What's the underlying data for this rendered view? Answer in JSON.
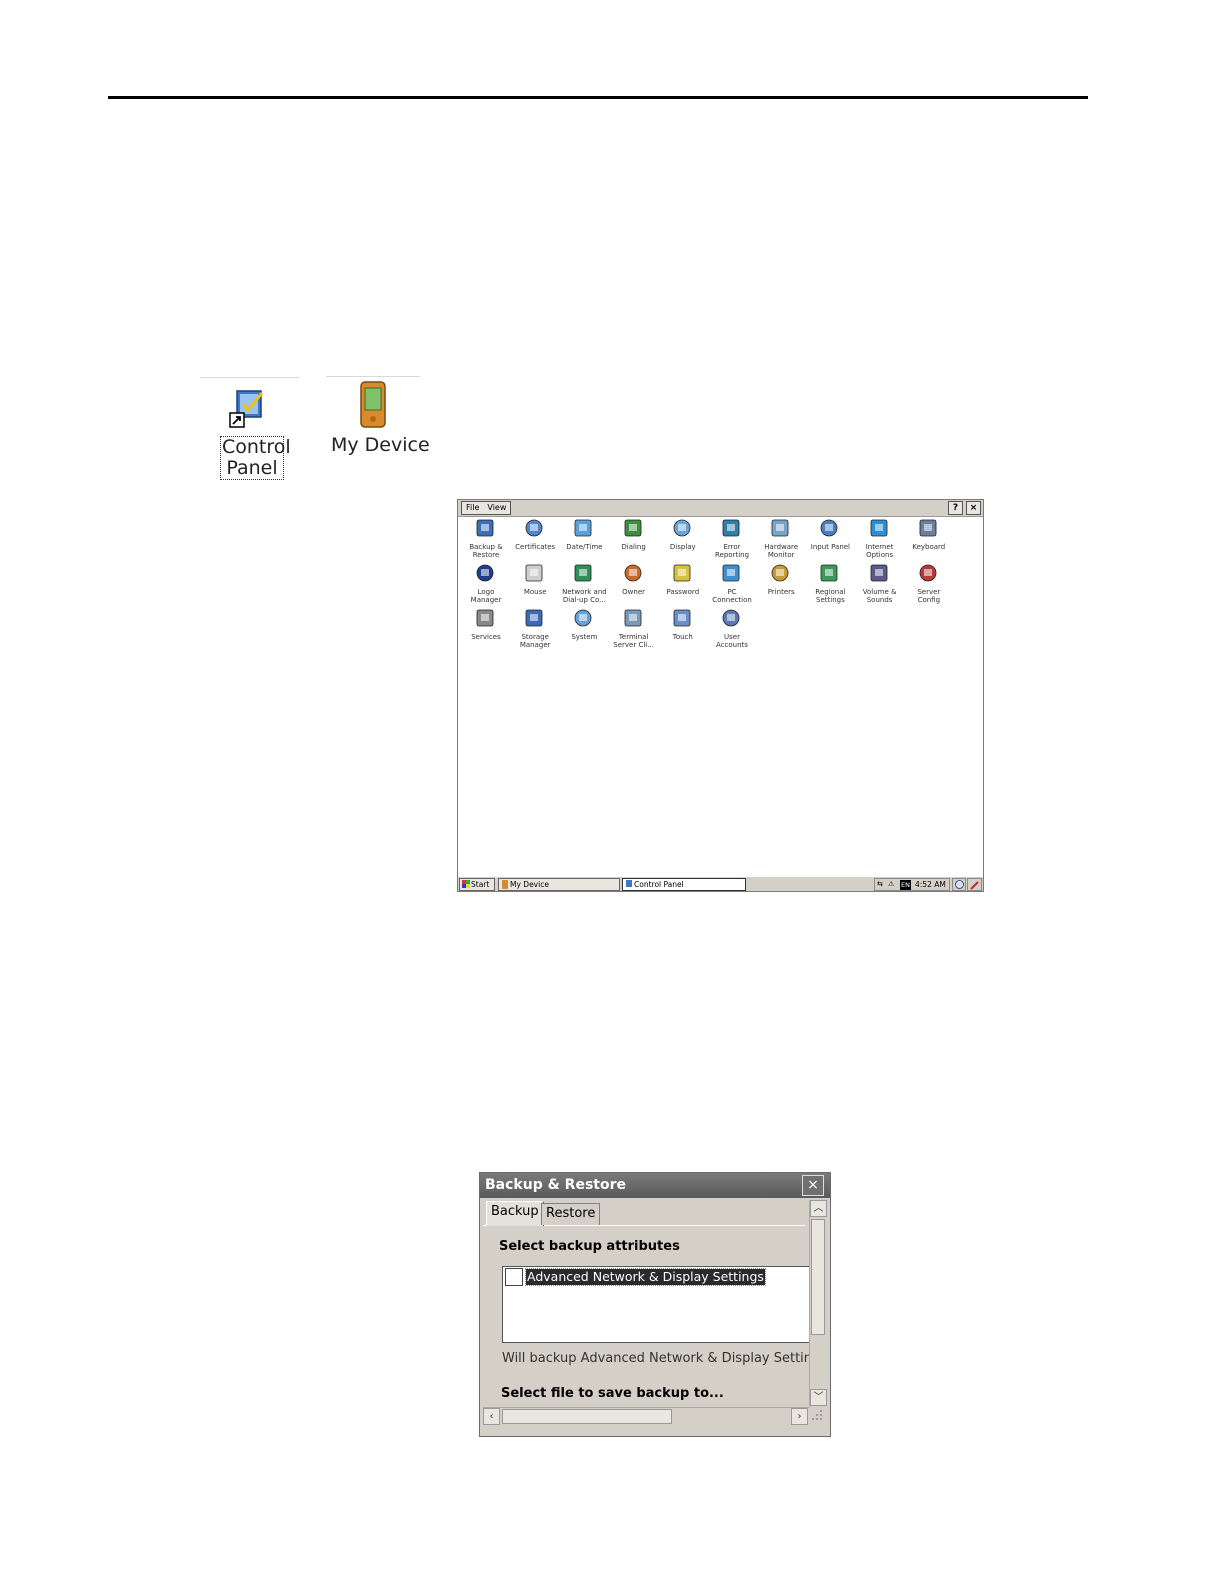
{
  "desktop": {
    "control_panel_label_line1": "Control",
    "control_panel_label_line2": "Panel",
    "my_device_label": "My Device"
  },
  "control_panel_window": {
    "menu": {
      "file": "File",
      "view": "View"
    },
    "title_buttons": {
      "help": "?",
      "close": "×"
    },
    "items": [
      {
        "label": "Backup &\nRestore",
        "icon": "floppy-icon"
      },
      {
        "label": "Certificates",
        "icon": "certificate-icon"
      },
      {
        "label": "Date/Time",
        "icon": "clock-icon"
      },
      {
        "label": "Dialing",
        "icon": "phone-icon"
      },
      {
        "label": "Display",
        "icon": "display-icon"
      },
      {
        "label": "Error\nReporting",
        "icon": "error-report-icon"
      },
      {
        "label": "Hardware\nMonitor",
        "icon": "hardware-monitor-icon"
      },
      {
        "label": "Input Panel",
        "icon": "input-panel-icon"
      },
      {
        "label": "Internet\nOptions",
        "icon": "globe-icon"
      },
      {
        "label": "Keyboard",
        "icon": "keyboard-icon"
      },
      {
        "label": "Logo\nManager",
        "icon": "ab-logo-icon"
      },
      {
        "label": "Mouse",
        "icon": "mouse-icon"
      },
      {
        "label": "Network and\nDial-up Co...",
        "icon": "network-globe-icon"
      },
      {
        "label": "Owner",
        "icon": "owner-icon"
      },
      {
        "label": "Password",
        "icon": "password-icon"
      },
      {
        "label": "PC\nConnection",
        "icon": "pc-connection-icon"
      },
      {
        "label": "Printers",
        "icon": "printer-icon"
      },
      {
        "label": "Regional\nSettings",
        "icon": "regional-globe-icon"
      },
      {
        "label": "Volume &\nSounds",
        "icon": "volume-icon"
      },
      {
        "label": "Server\nConfig",
        "icon": "server-config-icon"
      },
      {
        "label": "Services",
        "icon": "gears-icon"
      },
      {
        "label": "Storage\nManager",
        "icon": "storage-icon"
      },
      {
        "label": "System",
        "icon": "system-icon"
      },
      {
        "label": "Terminal\nServer Cli...",
        "icon": "terminal-server-icon"
      },
      {
        "label": "Touch",
        "icon": "touch-icon"
      },
      {
        "label": "User\nAccounts",
        "icon": "user-accounts-icon"
      }
    ],
    "taskbar": {
      "start": "Start",
      "my_device": "My Device",
      "control_panel": "Control Panel",
      "lang": "EN",
      "time": "4:52 AM"
    }
  },
  "backup_dialog": {
    "title": "Backup & Restore",
    "close": "×",
    "tabs": [
      "Backup",
      "Restore"
    ],
    "section_heading": "Select backup attributes",
    "list_item": "Advanced Network & Display Settings",
    "info_text": "Will backup Advanced Network & Display Settings if",
    "file_prompt": "Select file to save backup to..."
  },
  "colors": {
    "window_face": "#d4d0c8",
    "title_gray": "#6a6a6a",
    "selection": "#2a2a2a"
  }
}
